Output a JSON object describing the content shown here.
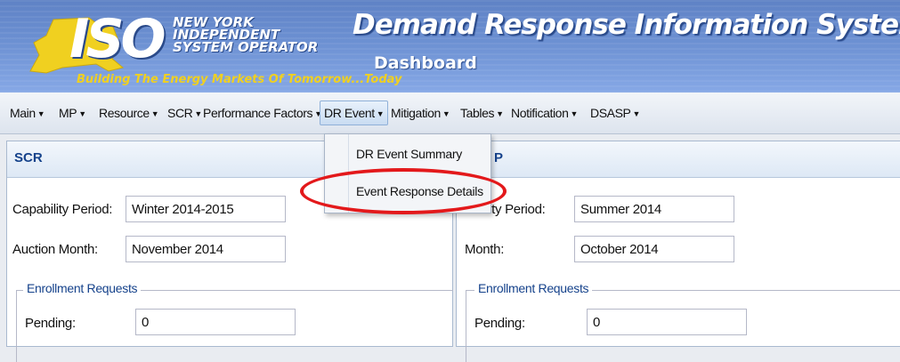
{
  "header": {
    "logo_text": "ISO",
    "org_line1": "NEW YORK",
    "org_line2": "INDEPENDENT",
    "org_line3": "SYSTEM OPERATOR",
    "tagline": "Building The Energy Markets Of Tomorrow...Today",
    "app_title": "Demand Response Information System",
    "page_title": "Dashboard",
    "colors": {
      "banner": "#6c90d2",
      "tagline": "#f0d020"
    }
  },
  "menu": {
    "items": [
      {
        "label": "Main"
      },
      {
        "label": "MP"
      },
      {
        "label": "Resource"
      },
      {
        "label": "SCR"
      },
      {
        "label": "Performance Factors"
      },
      {
        "label": "DR Event",
        "active": true
      },
      {
        "label": "Mitigation"
      },
      {
        "label": "Tables"
      },
      {
        "label": "Notification"
      },
      {
        "label": "DSASP"
      }
    ],
    "dropdown_icon": "caret-down-icon"
  },
  "dropdown": {
    "items": [
      {
        "label": "DR Event Summary"
      },
      {
        "label": "Event Response Details",
        "highlighted": true
      }
    ],
    "highlight_color": "#e3191b"
  },
  "scr_panel": {
    "title": "SCR",
    "capability_label": "Capability Period:",
    "capability_value": "Winter 2014-2015",
    "auction_label": "Auction Month:",
    "auction_value": "November 2014",
    "enrollment_legend": "Enrollment Requests",
    "pending_label": "Pending:",
    "pending_value": "0"
  },
  "right_panel": {
    "title": "P",
    "capability_label": "bility Period:",
    "capability_value": "Summer 2014",
    "month_label": "Month:",
    "month_value": "October 2014",
    "enrollment_legend": "Enrollment Requests",
    "pending_label": "Pending:",
    "pending_value": "0"
  }
}
